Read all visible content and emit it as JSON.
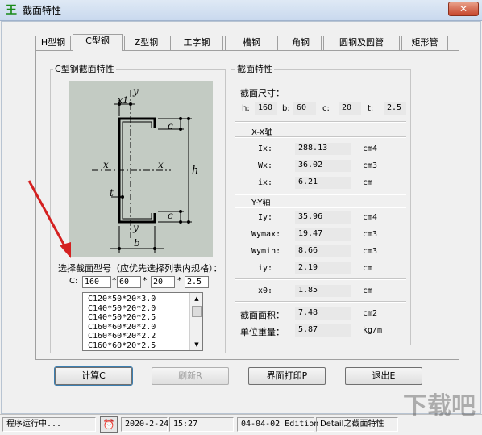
{
  "window": {
    "title": "截面特性"
  },
  "tabs": [
    "H型钢",
    "C型钢",
    "Z型钢",
    "工字钢",
    "槽钢",
    "角钢",
    "圆钢及圆管",
    "矩形管"
  ],
  "left_group": {
    "title": "C型钢截面特性",
    "diagram_labels": {
      "y_top": "y",
      "x1": "x1",
      "c_top": "c",
      "x_left": "x",
      "x_right": "x",
      "h": "h",
      "t": "t",
      "c_bottom": "c",
      "y_bottom": "y",
      "b": "b"
    },
    "select_label": "选择截面型号（应优先选择列表内规格）：",
    "c_label": "C:",
    "fields": [
      "160",
      "60",
      "20",
      "2.5"
    ],
    "separators": [
      "*",
      "*",
      "*"
    ],
    "list_items": [
      "C120*50*20*3.0",
      "C140*50*20*2.0",
      "C140*50*20*2.5",
      "C160*60*20*2.0",
      "C160*60*20*2.2",
      "C160*60*20*2.5"
    ]
  },
  "right_group": {
    "title": "截面特性",
    "dims_label": "截面尺寸：",
    "dims": [
      {
        "label": "h:",
        "value": "160"
      },
      {
        "label": "b:",
        "value": "60"
      },
      {
        "label": "c:",
        "value": "20"
      },
      {
        "label": "t:",
        "value": "2.5"
      }
    ],
    "xx_title": "X-X轴",
    "xx_rows": [
      {
        "label": "Ix:",
        "value": "288.13",
        "unit": "cm4"
      },
      {
        "label": "Wx:",
        "value": "36.02",
        "unit": "cm3"
      },
      {
        "label": "ix:",
        "value": "6.21",
        "unit": "cm"
      }
    ],
    "yy_title": "Y-Y轴",
    "yy_rows": [
      {
        "label": "Iy:",
        "value": "35.96",
        "unit": "cm4"
      },
      {
        "label": "Wymax:",
        "value": "19.47",
        "unit": "cm3"
      },
      {
        "label": "Wymin:",
        "value": "8.66",
        "unit": "cm3"
      },
      {
        "label": "iy:",
        "value": "2.19",
        "unit": "cm"
      }
    ],
    "x0": {
      "label": "x0:",
      "value": "1.85",
      "unit": "cm"
    },
    "area": {
      "label": "截面面积：",
      "value": "7.48",
      "unit": "cm2"
    },
    "weight": {
      "label": "单位重量：",
      "value": "5.87",
      "unit": "kg/m"
    }
  },
  "buttons": [
    "计算C",
    "刷新R",
    "界面打印P",
    "退出E"
  ],
  "status": {
    "running": "程序运行中...",
    "date": "2020-2-24",
    "time": "15:27",
    "edition": "04-04-02 Edition",
    "detail": "Detail之截面特性"
  },
  "watermark": "下载吧",
  "colors": {
    "diagram_bg": "#c3cbc3",
    "arrow": "#d42020",
    "titlebar": "#dfe9f5"
  }
}
